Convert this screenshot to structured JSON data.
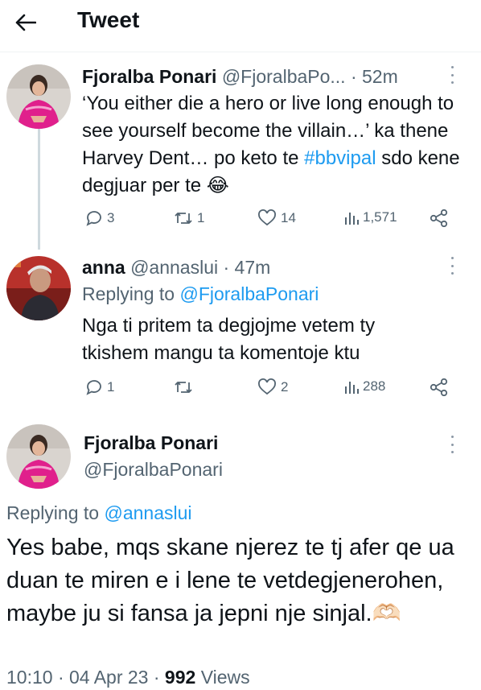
{
  "header": {
    "title": "Tweet",
    "back_icon": "arrow-left-icon"
  },
  "tweet1": {
    "name": "Fjoralba Ponari",
    "handle": "@FjoralbaPo...",
    "time": "· 52m",
    "text_before": "‘You either die a hero or live long enough to see yourself become the villain…’ ka thene Harvey Dent… po keto te ",
    "hashtag": "#bbvipal",
    "text_after": " sdo kene degjuar per te 😂",
    "replies": "3",
    "retweets": "1",
    "likes": "14",
    "views": "1,571"
  },
  "tweet2": {
    "name": "anna",
    "handle": "@annaslui",
    "time": "· 47m",
    "replying_label": "Replying to ",
    "replying_to": "@FjoralbaPonari",
    "text": "Nga ti pritem ta degjojme vetem ty tkishem mangu ta komentoje ktu",
    "replies": "1",
    "retweets": "",
    "likes": "2",
    "views": "288"
  },
  "main_tweet": {
    "name": "Fjoralba Ponari",
    "handle": "@FjoralbaPonari",
    "replying_label": "Replying to ",
    "replying_to": "@annaslui",
    "text": "Yes babe, mqs skane njerez te tj afer qe ua duan te miren e i lene te vetdegjenerohen, maybe ju si fansa ja jepni nje sinjal.🫶🏻",
    "time": "10:10",
    "date": "· 04 Apr 23 ·",
    "views_count": "992",
    "views_label": "Views"
  },
  "colors": {
    "accent": "#1d9bf0",
    "muted": "#536471",
    "text": "#0f1419",
    "line": "#cfd9de"
  }
}
